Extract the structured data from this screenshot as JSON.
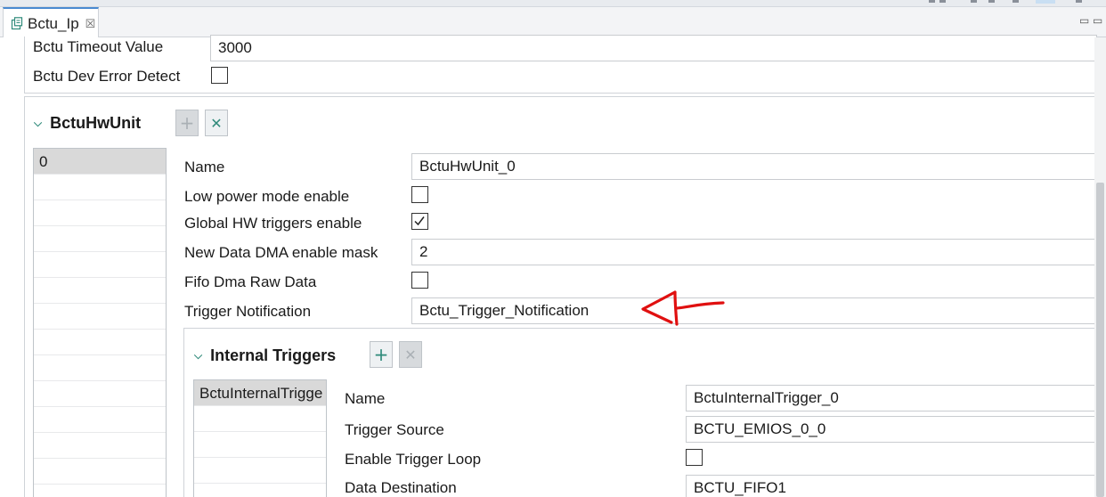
{
  "tab": {
    "title": "Bctu_Ip",
    "icon": "module-config-icon",
    "close_glyph": "☒"
  },
  "window": {
    "minimize_glyph": "▭",
    "maximize_glyph": "▭"
  },
  "general": {
    "timeout": {
      "label": "Bctu Timeout Value",
      "value": "3000"
    },
    "dev_error": {
      "label": "Bctu Dev Error Detect",
      "checked": false
    }
  },
  "hw_unit": {
    "title": "BctuHwUnit",
    "add_glyph": "+",
    "remove_glyph": "✕",
    "list": [
      "0"
    ],
    "fields": {
      "name": {
        "label": "Name",
        "value": "BctuHwUnit_0"
      },
      "low_power": {
        "label": "Low power mode enable",
        "checked": false
      },
      "global_hw": {
        "label": "Global HW triggers enable",
        "checked": true
      },
      "dma_mask": {
        "label": "New Data DMA enable mask",
        "value": "2"
      },
      "fifo_raw": {
        "label": "Fifo Dma Raw Data",
        "checked": false
      },
      "trigger_notif": {
        "label": "Trigger Notification",
        "value": "Bctu_Trigger_Notification"
      }
    }
  },
  "internal_triggers": {
    "title": "Internal Triggers",
    "add_glyph": "+",
    "remove_glyph": "✕",
    "list": [
      "BctuInternalTrigger_0"
    ],
    "list_visible": "BctuInternalTrigge",
    "fields": {
      "name": {
        "label": "Name",
        "value": "BctuInternalTrigger_0"
      },
      "source": {
        "label": "Trigger Source",
        "value": "BCTU_EMIOS_0_0"
      },
      "loop": {
        "label": "Enable Trigger Loop",
        "checked": false
      },
      "dest": {
        "label": "Data Destination",
        "value": "BCTU_FIFO1"
      }
    }
  },
  "colors": {
    "accent": "#2f8a7a",
    "tab_highlight": "#4a8ad0",
    "annotation": "#e01010"
  }
}
